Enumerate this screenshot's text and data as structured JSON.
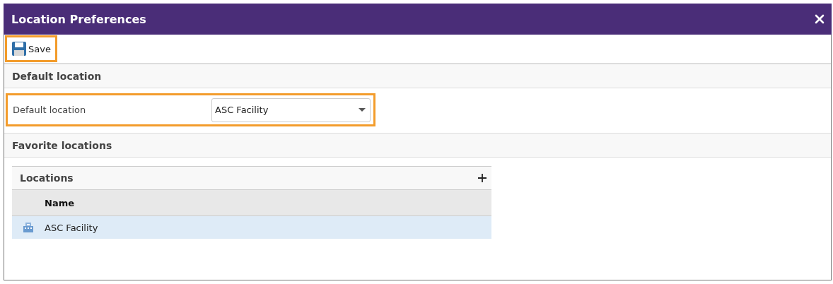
{
  "window": {
    "title": "Location Preferences"
  },
  "toolbar": {
    "save": {
      "label": "Save",
      "highlighted": true
    }
  },
  "default_section": {
    "title": "Default location",
    "field": {
      "label": "Default location",
      "value": "ASC Facility",
      "highlighted": true
    }
  },
  "favorites_section": {
    "title": "Favorite locations",
    "grid": {
      "title": "Locations",
      "columns": [
        "Name"
      ],
      "rows": [
        {
          "name": "ASC Facility",
          "selected": true
        }
      ]
    }
  }
}
